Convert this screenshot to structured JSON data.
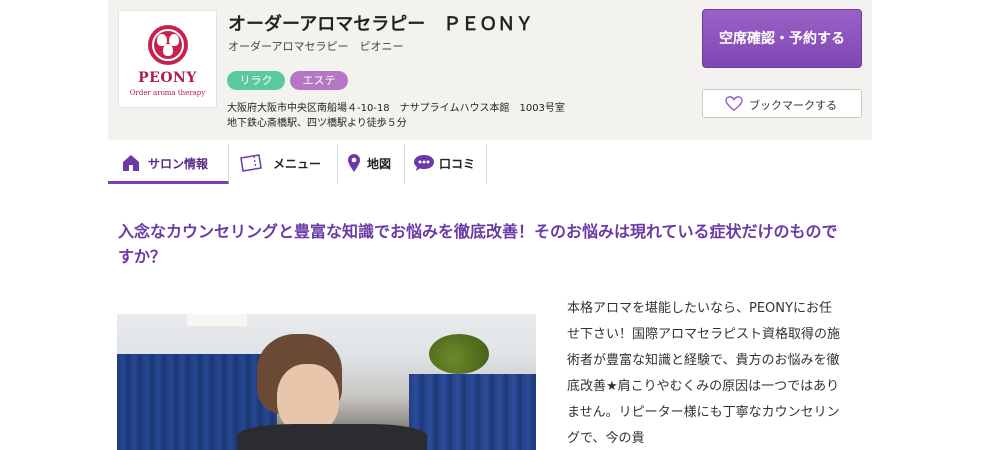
{
  "header": {
    "logo": {
      "name": "PEONY",
      "subtitle": "Order aroma therapy"
    },
    "title": "オーダーアロマセラピー　ＰＥＯＮＹ",
    "kana": "オーダーアロマセラピー　ピオニー",
    "tags": [
      "リラク",
      "エステ"
    ],
    "address_line1": "大阪府大阪市中央区南船場４-10-18　ナサプライムハウス本館　1003号室",
    "address_line2": "地下鉄心斎橋駅、四ツ橋駅より徒歩５分",
    "reserve_label": "空席確認・予約する",
    "bookmark_label": "ブックマークする"
  },
  "tabs": [
    {
      "label": "サロン情報",
      "icon": "home-icon",
      "active": true
    },
    {
      "label": "メニュー",
      "icon": "ticket-icon",
      "active": false
    },
    {
      "label": "地図",
      "icon": "map-pin-icon",
      "active": false
    },
    {
      "label": "口コミ",
      "icon": "chat-bubble-icon",
      "active": false
    }
  ],
  "main": {
    "headline": "入念なカウンセリングと豊富な知識でお悩みを徹底改善！そのお悩みは現れている症状だけのものですか？",
    "body": "本格アロマを堪能したいなら、PEONYにお任せ下さい！国際アロマセラピスト資格取得の施術者が豊富な知識と経験で、貴方のお悩みを徹底改善★肩こりやむくみの原因は一つではありません。リピーター様にも丁寧なカウンセリングで、今の貴"
  },
  "colors": {
    "accent": "#7a3fb0",
    "reserve_button": "#8a52bc",
    "tag_relax": "#5cc8a0",
    "tag_esthe": "#b676c6",
    "logo_red": "#c4234d",
    "header_bg": "#f3f2ef"
  }
}
